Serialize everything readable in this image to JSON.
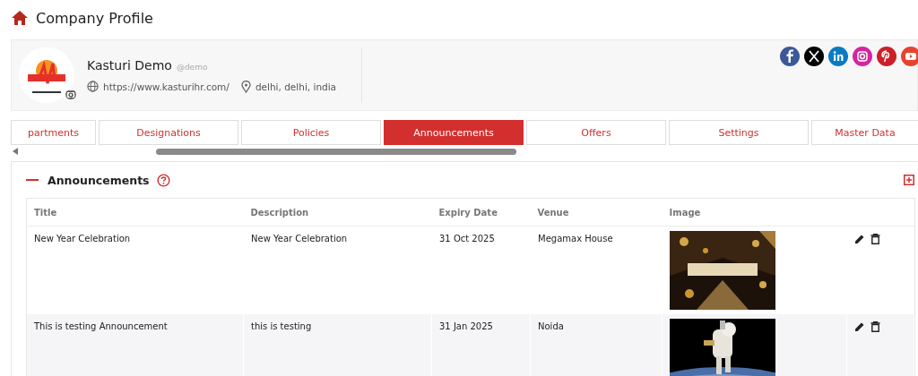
{
  "page": {
    "title": "Company Profile"
  },
  "profile": {
    "name": "Kasturi Demo",
    "handle": "@demo",
    "website": "https://www.kasturihr.com/",
    "location": "delhi, delhi, india"
  },
  "social": [
    {
      "kind": "facebook",
      "color": "#3b5998"
    },
    {
      "kind": "x",
      "color": "#000000"
    },
    {
      "kind": "linkedin",
      "color": "#0a7bc1"
    },
    {
      "kind": "instagram",
      "color": "#d6249f"
    },
    {
      "kind": "pinterest",
      "color": "#cb2027"
    },
    {
      "kind": "youtube",
      "color": "#e8432f"
    }
  ],
  "tabs": [
    {
      "label": "partments",
      "selected": false
    },
    {
      "label": "Designations",
      "selected": false
    },
    {
      "label": "Policies",
      "selected": false
    },
    {
      "label": "Announcements",
      "selected": true
    },
    {
      "label": "Offers",
      "selected": false
    },
    {
      "label": "Settings",
      "selected": false
    },
    {
      "label": "Master Data",
      "selected": false
    }
  ],
  "section": {
    "title": "Announcements",
    "expanded": true
  },
  "table": {
    "columns": [
      "Title",
      "Description",
      "Expiry Date",
      "Venue",
      "Image"
    ],
    "rows": [
      {
        "cells": [
          "New Year Celebration",
          "New Year Celebration",
          "31 Oct 2025",
          "Megamax House"
        ],
        "image": {
          "kind": "picture"
        }
      },
      {
        "cells": [
          "This is testing Announcement",
          "this is testing",
          "31 Jan 2025",
          "Noida"
        ],
        "image": {
          "kind": "picture"
        }
      }
    ]
  }
}
